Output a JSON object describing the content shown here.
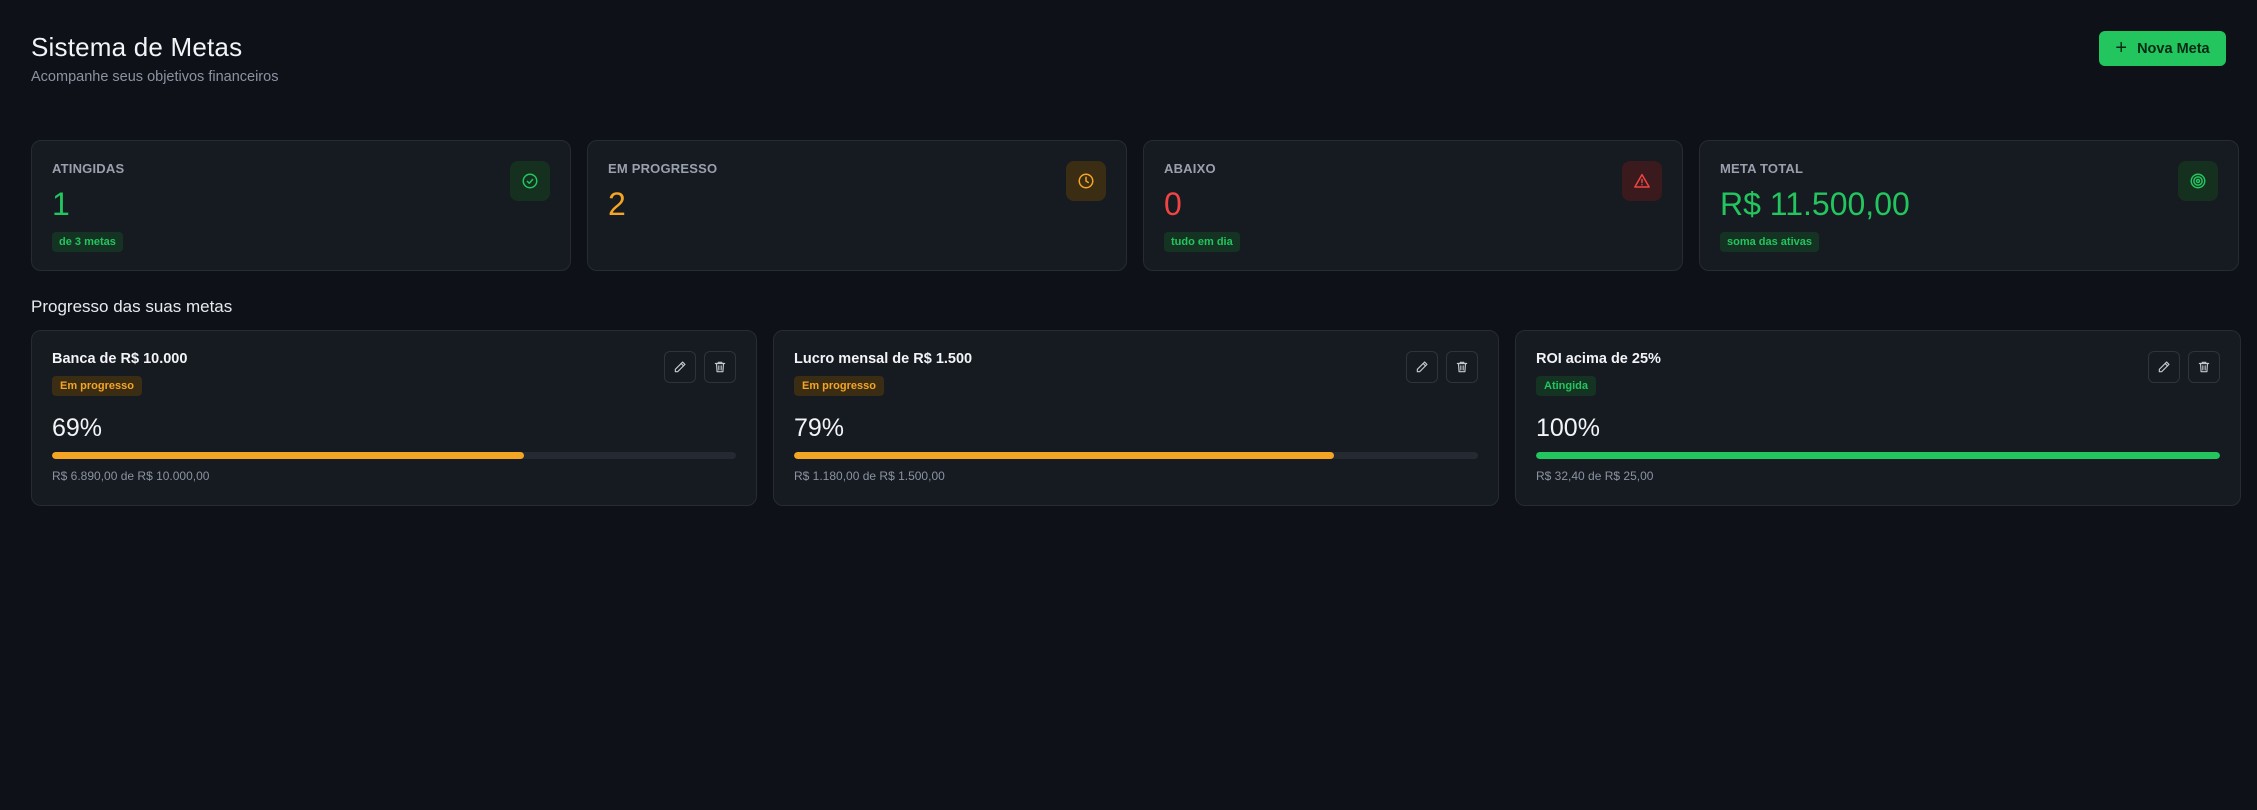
{
  "header": {
    "title": "Sistema de Metas",
    "subtitle": "Acompanhe seus objetivos financeiros",
    "new_button_label": "Nova Meta",
    "new_button_icon": "plus-icon"
  },
  "stats": [
    {
      "label": "ATINGIDAS",
      "value": "1",
      "pill": "de 3 metas",
      "icon": "check-circle-icon",
      "color": "#22c55e"
    },
    {
      "label": "EM PROGRESSO",
      "value": "2",
      "pill": "",
      "icon": "clock-icon",
      "color": "#f5a524"
    },
    {
      "label": "ABAIXO",
      "value": "0",
      "pill": "tudo em dia",
      "icon": "alert-triangle-icon",
      "color": "#ef4444"
    },
    {
      "label": "META TOTAL",
      "value": "R$ 11.500,00",
      "pill": "soma das ativas",
      "icon": "target-icon",
      "color": "#22c55e"
    }
  ],
  "section_title": "Progresso das suas metas",
  "goals": [
    {
      "title": "Banca de R$ 10.000",
      "status": "Em progresso",
      "percent_label": "69%",
      "progress": 0.69,
      "amount": "R$ 6.890,00 de R$ 10.000,00",
      "bar_color": "#f5a524"
    },
    {
      "title": "Lucro mensal de R$ 1.500",
      "status": "Em progresso",
      "percent_label": "79%",
      "progress": 0.79,
      "amount": "R$ 1.180,00 de R$ 1.500,00",
      "bar_color": "#f5a524"
    },
    {
      "title": "ROI acima de 25%",
      "status": "Atingida",
      "percent_label": "100%",
      "progress": 1.0,
      "amount": "R$ 32,40 de R$ 25,00",
      "bar_color": "#22c55e"
    }
  ],
  "actions": {
    "edit_icon": "pencil-icon",
    "delete_icon": "trash-icon"
  }
}
